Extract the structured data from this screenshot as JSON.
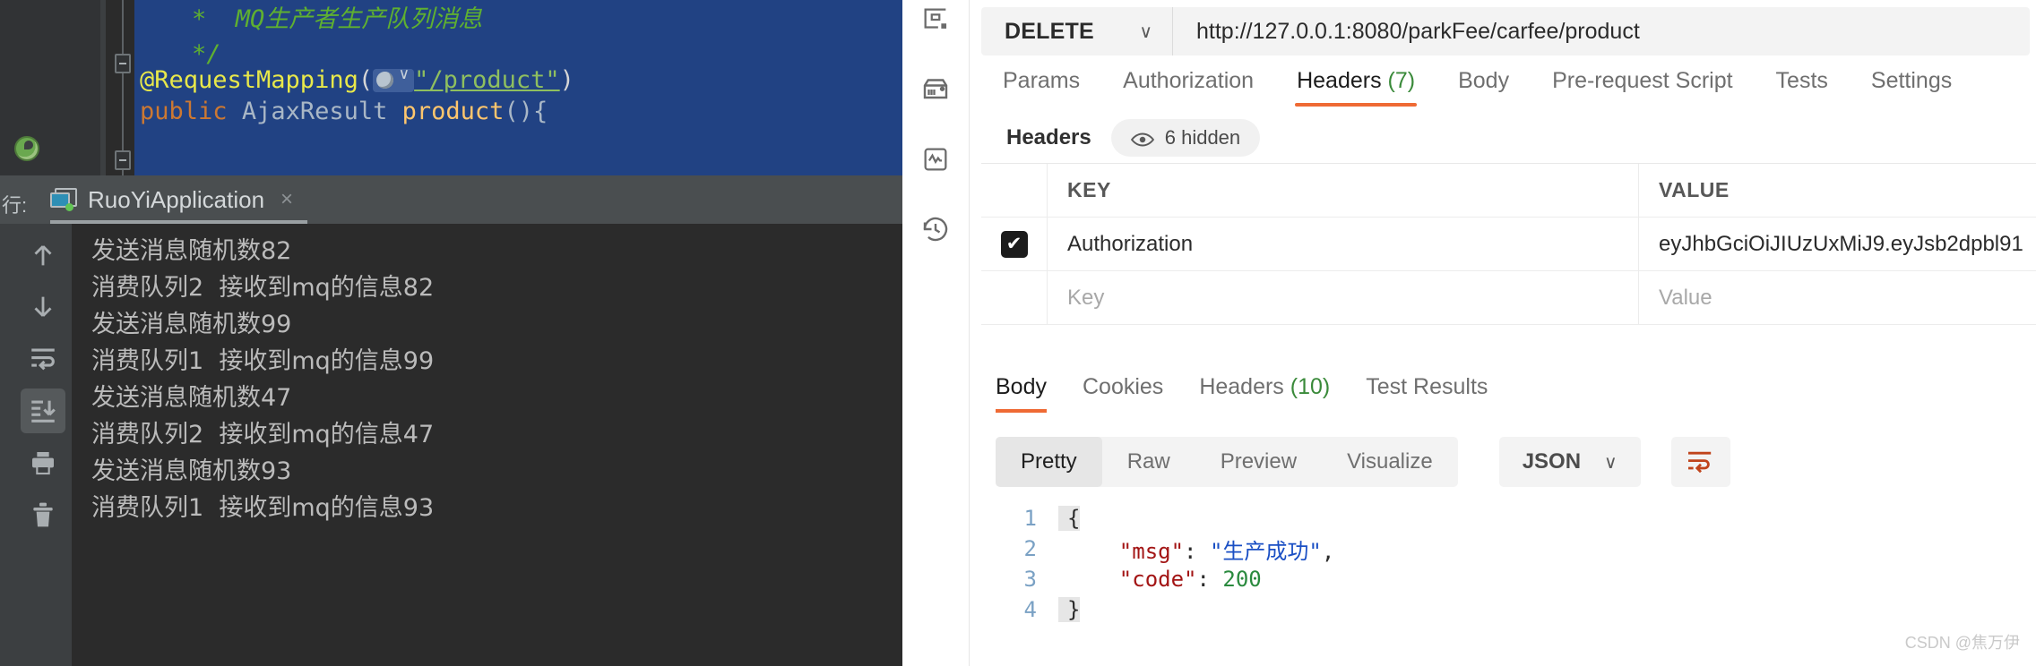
{
  "ide": {
    "editor": {
      "lines": [
        {
          "indent": "*  ",
          "text": "MQ生产者生产队列消息",
          "kind": "comment"
        },
        {
          "text": "*/",
          "kind": "comment"
        },
        {
          "text": "@RequestMapping(",
          "kind": "annotation"
        },
        {
          "text": "public AjaxResult product(){",
          "kind": "code"
        }
      ],
      "annotation_name": "@RequestMapping",
      "mapping_path": "\"/product\"",
      "closing_paren": ")",
      "keyword_public": "public",
      "class_AjaxResult": "AjaxResult",
      "method_product": "product",
      "method_tail": "(){"
    },
    "run_window": {
      "label": "行:",
      "tab_title": "RuoYiApplication",
      "close_label": "×",
      "toolbar_items": [
        {
          "name": "scroll-up",
          "label": "Up the Stack Trace"
        },
        {
          "name": "scroll-down",
          "label": "Down the Stack Trace"
        },
        {
          "name": "soft-wrap",
          "label": "Soft-Wrap"
        },
        {
          "name": "scroll-to-end",
          "label": "Scroll to the End"
        },
        {
          "name": "print",
          "label": "Print"
        },
        {
          "name": "clear-all",
          "label": "Clear All"
        }
      ],
      "console_lines": [
        "发送消息随机数82",
        "消费队列2  接收到mq的信息82",
        "发送消息随机数99",
        "消费队列1  接收到mq的信息99",
        "发送消息随机数47",
        "消费队列2  接收到mq的信息47",
        "发送消息随机数93",
        "消费队列1  接收到mq的信息93"
      ]
    }
  },
  "postman": {
    "rail_icons": [
      {
        "name": "new-request-icon"
      },
      {
        "name": "environment-icon"
      },
      {
        "name": "monitor-icon"
      },
      {
        "name": "history-icon"
      }
    ],
    "request": {
      "method": "DELETE",
      "method_chevron": "∨",
      "url": "http://127.0.0.1:8080/parkFee/carfee/product",
      "tabs": [
        {
          "label": "Params",
          "count": "",
          "active": false
        },
        {
          "label": "Authorization",
          "count": "",
          "active": false
        },
        {
          "label": "Headers",
          "count": "(7)",
          "active": true
        },
        {
          "label": "Body",
          "count": "",
          "active": false
        },
        {
          "label": "Pre-request Script",
          "count": "",
          "active": false
        },
        {
          "label": "Tests",
          "count": "",
          "active": false
        },
        {
          "label": "Settings",
          "count": "",
          "active": false
        }
      ]
    },
    "headers_section": {
      "title": "Headers",
      "hidden_badge": "6 hidden",
      "columns": {
        "key": "KEY",
        "value": "VALUE"
      },
      "rows": [
        {
          "checked": true,
          "check_glyph": "✔",
          "key": "Authorization",
          "value": "eyJhbGciOiJIUzUxMiJ9.eyJsb2dpbl91"
        }
      ],
      "new_row": {
        "key_placeholder": "Key",
        "value_placeholder": "Value"
      }
    },
    "response": {
      "tabs": [
        {
          "label": "Body",
          "count": "",
          "active": true
        },
        {
          "label": "Cookies",
          "count": "",
          "active": false
        },
        {
          "label": "Headers",
          "count": "(10)",
          "active": false
        },
        {
          "label": "Test Results",
          "count": "",
          "active": false
        }
      ],
      "format_modes": [
        {
          "label": "Pretty",
          "active": true
        },
        {
          "label": "Raw",
          "active": false
        },
        {
          "label": "Preview",
          "active": false
        },
        {
          "label": "Visualize",
          "active": false
        }
      ],
      "language": "JSON",
      "language_chevron": "∨",
      "wrap_icon": "word-wrap-icon",
      "body_lines": [
        {
          "num": "1",
          "segments": [
            {
              "t": "{",
              "c": "brace"
            }
          ]
        },
        {
          "num": "2",
          "segments": [
            {
              "t": "    ",
              "c": "pun"
            },
            {
              "t": "\"msg\"",
              "c": "key"
            },
            {
              "t": ": ",
              "c": "pun"
            },
            {
              "t": "\"生产成功\"",
              "c": "str"
            },
            {
              "t": ",",
              "c": "pun"
            }
          ]
        },
        {
          "num": "3",
          "segments": [
            {
              "t": "    ",
              "c": "pun"
            },
            {
              "t": "\"code\"",
              "c": "key"
            },
            {
              "t": ": ",
              "c": "pun"
            },
            {
              "t": "200",
              "c": "num"
            }
          ]
        },
        {
          "num": "4",
          "segments": [
            {
              "t": "}",
              "c": "brace"
            }
          ]
        }
      ]
    }
  },
  "watermark": "CSDN @焦万伊",
  "colors": {
    "postman_accent": "#ef6a34",
    "count_green": "#3a8a3a",
    "ide_selection": "#214283",
    "ide_console_bg": "#2b2b2b"
  }
}
